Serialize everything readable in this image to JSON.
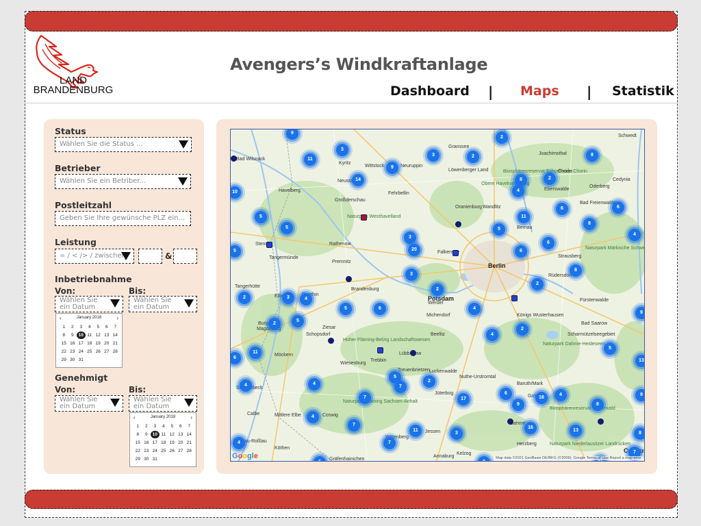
{
  "header": {
    "logo_line1": "LAND",
    "logo_line2": "BRANDENBURG",
    "title": "Avengers’s Windkraftanlage",
    "nav": {
      "dashboard": "Dashboard",
      "maps": "Maps",
      "statistik": "Statistik",
      "separator": "|"
    },
    "active_tab": "Maps"
  },
  "colors": {
    "brand_red": "#c83c33",
    "panel_bg": "#f8e6d8",
    "cluster_blue": "#1a73e8"
  },
  "filters": {
    "status": {
      "label": "Status",
      "placeholder": "Wählen Sie die Status ..."
    },
    "betrieber": {
      "label": "Betrieber",
      "placeholder": "Wählen Sie ein Betriber..."
    },
    "postleitzahl": {
      "label": "Postleitzahl",
      "placeholder": "Geben Sie Ihre gewünsche PLZ ein..."
    },
    "leistung": {
      "label": "Leistung",
      "operator_placeholder": "= / < /> / zwischen",
      "and_symbol": "&"
    },
    "inbetriebnahme": {
      "label": "Inbetriebnahme",
      "von": "Von:",
      "bis": "Bis:",
      "date_placeholder": "Wählen Sie ein Datum"
    },
    "genehmigt": {
      "label": "Genehmigt",
      "von": "Von:",
      "bis": "Bis:",
      "date_placeholder": "Wählen Sie ein Datum"
    },
    "calendar": {
      "month": "January 2018",
      "prev": "‹",
      "next": "›",
      "days": [
        "1",
        "2",
        "3",
        "4",
        "5",
        "6",
        "7",
        "8",
        "9",
        "10",
        "11",
        "12",
        "13",
        "14",
        "15",
        "16",
        "17",
        "18",
        "19",
        "20",
        "21",
        "22",
        "23",
        "24",
        "25",
        "26",
        "27",
        "28",
        "29",
        "30",
        "31"
      ],
      "selected": "10"
    }
  },
  "map": {
    "google_label": "Google",
    "attribution": "Map data ©2021 GeoBasis-DE/BKG (©2009), Google   Terms of Use   Report a map error",
    "clusters": [
      "9",
      "2",
      "8",
      "3",
      "11",
      "9",
      "14",
      "3",
      "2",
      "8",
      "2",
      "4",
      "10",
      "5",
      "5",
      "11",
      "6",
      "6",
      "5",
      "3",
      "20",
      "5",
      "6",
      "6",
      "8",
      "8",
      "2",
      "4",
      "3",
      "3",
      "2",
      "6",
      "4",
      "2",
      "2",
      "4",
      "5",
      "6",
      "5",
      "2",
      "4",
      "4",
      "7",
      "11",
      "5",
      "5",
      "9",
      "6",
      "17",
      "7",
      "2",
      "4",
      "4",
      "16",
      "9",
      "4",
      "13",
      "8",
      "13",
      "7",
      "11",
      "3",
      "8",
      "4",
      "16",
      "6",
      "11",
      "7",
      "9",
      "9",
      "7"
    ],
    "places": [
      "Schwedt",
      "Granssee",
      "Bad Wilsnack",
      "Kyritz",
      "Wittstock",
      "Neuruppin",
      "Löwenberger Land",
      "Biosphärenreservat Schorfheide-Chorin",
      "Joachimsthal",
      "Chorin",
      "Havelberg",
      "Neustadt",
      "Fehrbellin",
      "Oranienburg",
      "Eberswalde",
      "Oderberg",
      "Cedynia",
      "Großderschau",
      "Obere Havelniederung",
      "Wandlitz",
      "Bad Freienwalde",
      "Naturpark Westhavelland",
      "Rathenow",
      "Falkensee",
      "Berlin",
      "Strausberg",
      "Naturpark Märkische Schweiz",
      "Stendal",
      "Tangermünde",
      "Premnitz",
      "Rüdersdorf",
      "Tangerhütte",
      "Genthin",
      "Brandenburg",
      "Potsdam",
      "Werder",
      "Fürstenwalde",
      "Burg",
      "Michendorf",
      "Königs Wusterhausen",
      "Bad Saarow",
      "Magdeburg",
      "Ziesar",
      "Schopsdorf",
      "Beelitz",
      "Scharmützelseegebiet",
      "Möckern",
      "Hoher Fläming-Belzig Landschaftswesen",
      "Lübbenow",
      "Naturpark Dahme-Heideseen",
      "Wiesenburg",
      "Treuenbrietzen",
      "Luckenwalde",
      "Nuthe-Urstromtal",
      "Schönebeck",
      "Jüterbog",
      "Baruth/Mark",
      "Golssen",
      "Calbe",
      "Naturpark Fläming Sachsen-Anhalt",
      "Coswig",
      "Wittenberg",
      "Dessau-Roßlau",
      "Jessen",
      "Biosphärenreservat Spreewald",
      "Köthen",
      "Herzberg",
      "Dahme",
      "Naturpark Niederlausitzer Landrücken",
      "Annaburg",
      "Cottbus",
      "Elbe",
      "Mittlere Elbe",
      "Gräfenhainichen",
      "Kelzog",
      "Bernau",
      "Trebbin"
    ]
  }
}
